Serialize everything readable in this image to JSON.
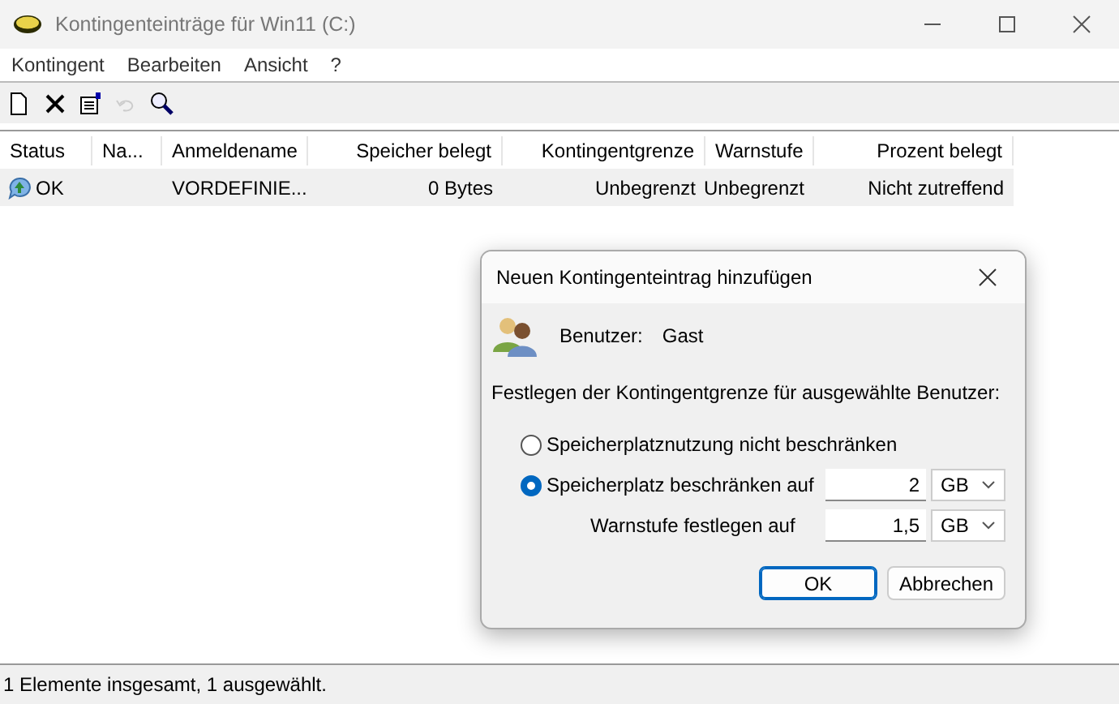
{
  "window": {
    "title": "Kontingenteinträge für Win11 (C:)"
  },
  "menu": [
    "Kontingent",
    "Bearbeiten",
    "Ansicht",
    "?"
  ],
  "toolbar": [
    {
      "kind": "new",
      "disabled": false
    },
    {
      "kind": "delete",
      "disabled": false
    },
    {
      "kind": "properties",
      "disabled": false
    },
    {
      "kind": "undo",
      "disabled": true
    },
    {
      "kind": "find",
      "disabled": false
    }
  ],
  "table": {
    "columns": [
      "Status",
      "Na...",
      "Anmeldename",
      "Speicher belegt",
      "Kontingentgrenze",
      "Warnstufe",
      "Prozent belegt"
    ],
    "rows": [
      {
        "selected": true,
        "cells": [
          "OK",
          "",
          "VORDEFINIE...",
          "0 Bytes",
          "Unbegrenzt",
          "Unbegrenzt",
          "Nicht zutreffend"
        ]
      }
    ]
  },
  "dialog": {
    "title": "Neuen Kontingenteintrag hinzufügen",
    "user_label": "Benutzer:",
    "user": "Gast",
    "instruction": "Festlegen der Kontingentgrenze für ausgewählte Benutzer:",
    "options": [
      {
        "label": "Speicherplatznutzung nicht beschränken",
        "selected": false
      },
      {
        "label": "Speicherplatz beschränken auf",
        "selected": true,
        "value": "2",
        "unit": "GB"
      }
    ],
    "warning": {
      "label": "Warnstufe festlegen auf",
      "value": "1,5",
      "unit": "GB"
    },
    "buttons": [
      {
        "label": "OK",
        "default": true
      },
      {
        "label": "Abbrechen",
        "default": false
      }
    ]
  },
  "status_bar": "1 Elemente insgesamt, 1 ausgewählt."
}
